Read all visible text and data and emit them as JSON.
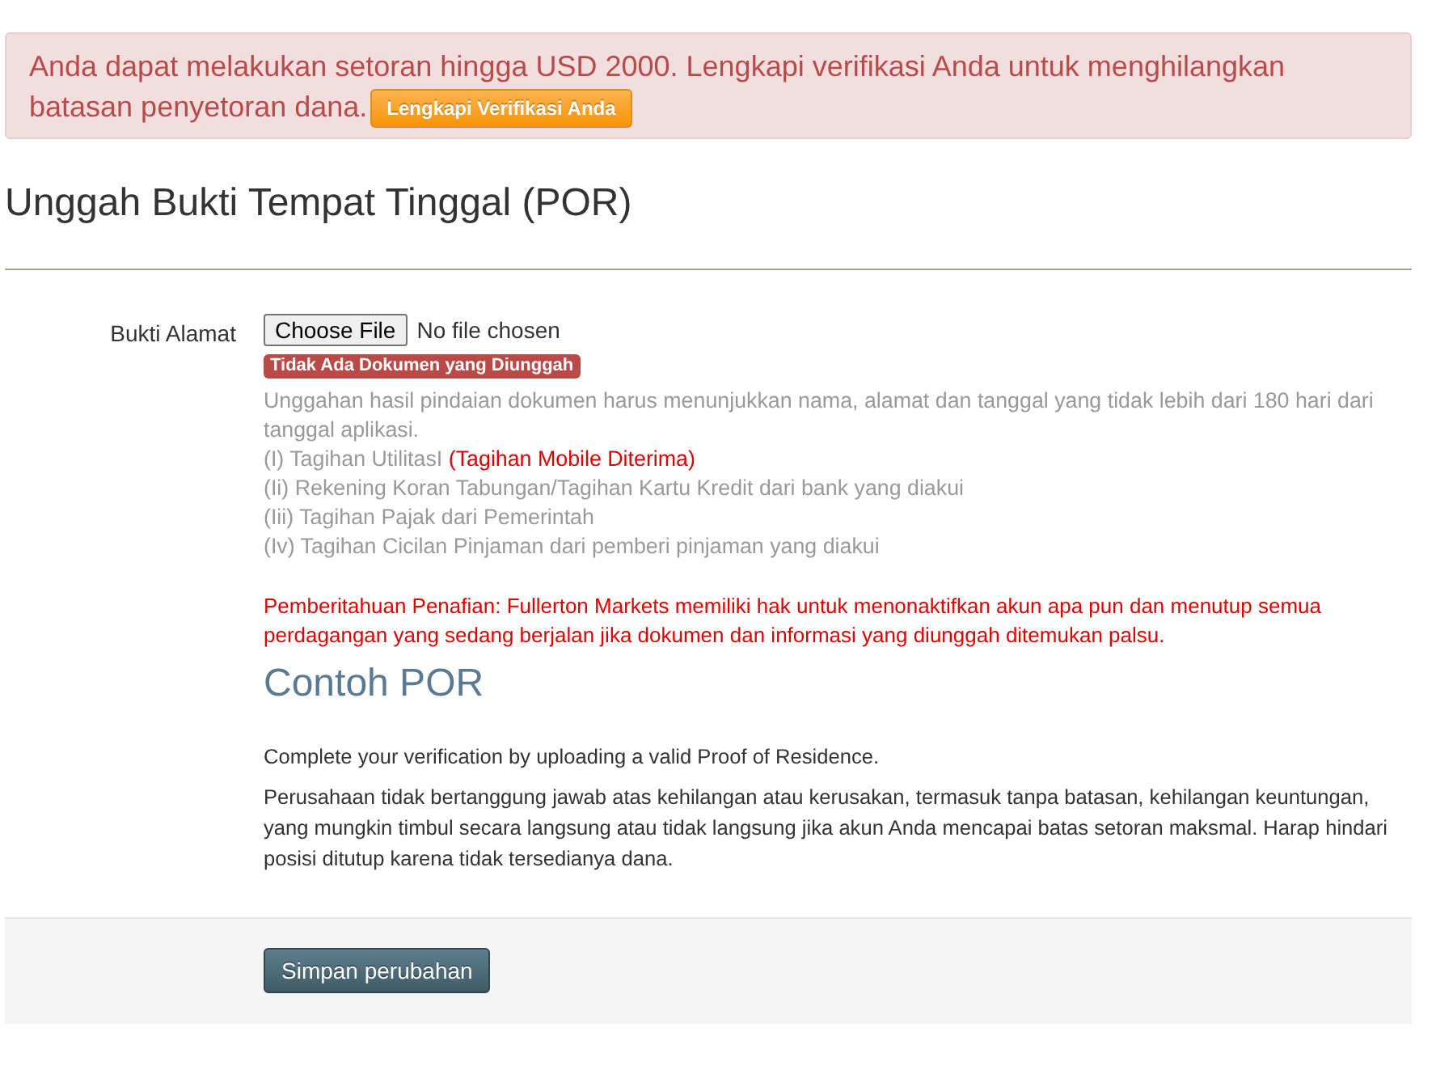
{
  "alert": {
    "message_lines": [
      "Anda dapat melakukan setoran hingga USD 2000. Lengkapi verifikasi Anda untuk menghilangkan",
      "batasan penyetoran dana."
    ],
    "button": "Lengkapi Verifikasi Anda"
  },
  "page_title": "Unggah Bukti Tempat Tinggal (POR)",
  "form": {
    "label": "Bukti Alamat",
    "file_button": "Choose File",
    "file_status": "No file chosen",
    "status_badge": "Tidak Ada Dokumen yang Diunggah",
    "instructions": "Unggahan hasil pindaian dokumen harus menunjukkan nama, alamat dan tanggal yang tidak lebih dari 180 hari dari tanggal aplikasi.",
    "documents": [
      {
        "text": "(I) Tagihan UtilitasI",
        "note": "(Tagihan Mobile Diterima)"
      },
      {
        "text": "(Ii) Rekening Koran Tabungan/Tagihan Kartu Kredit dari bank yang diakui"
      },
      {
        "text": "(Iii) Tagihan Pajak dari Pemerintah"
      },
      {
        "text": "(Iv) Tagihan Cicilan Pinjaman dari pemberi pinjaman yang diakui"
      }
    ],
    "disclaimer": "Pemberitahuan Penafian: Fullerton Markets memiliki hak untuk menonaktifkan akun apa pun dan menutup semua perdagangan yang sedang berjalan jika dokumen dan informasi yang diunggah ditemukan palsu.",
    "example_title": "Contoh POR",
    "paragraphs": [
      "Complete your verification by uploading a valid Proof of Residence.",
      "Perusahaan tidak bertanggung jawab atas kehilangan atau kerusakan, termasuk tanpa batasan, kehilangan keuntungan, yang mungkin timbul secara langsung atau tidak langsung jika akun Anda mencapai batas setoran maksmal. Harap hindari posisi ditutup karena tidak tersedianya dana."
    ]
  },
  "footer": {
    "save_button": "Simpan perubahan"
  }
}
